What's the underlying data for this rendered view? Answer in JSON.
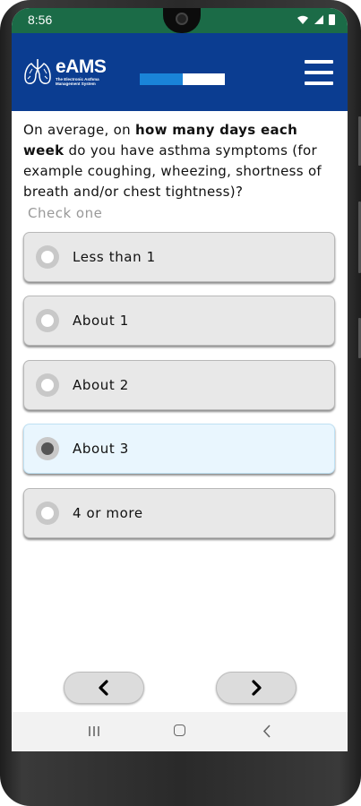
{
  "status_bar": {
    "time": "8:56",
    "icons": [
      "wifi-icon",
      "signal-icon",
      "battery-icon"
    ]
  },
  "header": {
    "logo_title": "eAMS",
    "logo_subtitle_line1": "The Electronic Asthma",
    "logo_subtitle_line2": "Management System",
    "progress": 0.5,
    "colors": {
      "header_bg": "#0b3d91",
      "progress_fill": "#1a84d8",
      "status_bg": "#1b6b47"
    }
  },
  "question": {
    "prefix": "On average, on ",
    "emphasis": "how many days each week",
    "suffix": " do you have asthma symptoms (for example coughing, wheezing, shortness of breath and/or chest tightness)?"
  },
  "instruction": "Check one",
  "options": [
    {
      "label": "Less than 1",
      "selected": false
    },
    {
      "label": "About 1",
      "selected": false
    },
    {
      "label": "About 2",
      "selected": false
    },
    {
      "label": "About 3",
      "selected": true
    },
    {
      "label": "4 or more",
      "selected": false
    }
  ],
  "navigation": {
    "back_icon": "chevron-left-icon",
    "next_icon": "chevron-right-icon"
  },
  "system_nav": [
    "recent-apps-icon",
    "home-icon",
    "back-icon"
  ]
}
